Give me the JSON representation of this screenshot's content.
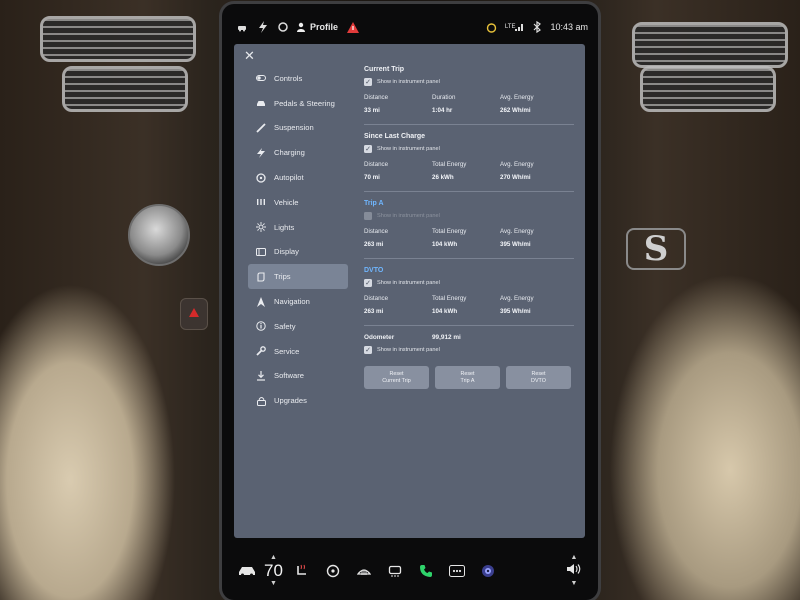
{
  "status_bar": {
    "profile_label": "Profile",
    "network_label": "LTE",
    "time": "10:43 am"
  },
  "sidebar": {
    "items": [
      {
        "label": "Controls",
        "icon": "toggle-icon"
      },
      {
        "label": "Pedals & Steering",
        "icon": "car-icon"
      },
      {
        "label": "Suspension",
        "icon": "suspension-icon"
      },
      {
        "label": "Charging",
        "icon": "lightning-icon"
      },
      {
        "label": "Autopilot",
        "icon": "steering-wheel-icon"
      },
      {
        "label": "Vehicle",
        "icon": "vehicle-bars-icon"
      },
      {
        "label": "Lights",
        "icon": "sun-icon"
      },
      {
        "label": "Display",
        "icon": "display-icon"
      },
      {
        "label": "Trips",
        "icon": "trips-icon"
      },
      {
        "label": "Navigation",
        "icon": "navigation-icon"
      },
      {
        "label": "Safety",
        "icon": "info-icon"
      },
      {
        "label": "Service",
        "icon": "wrench-icon"
      },
      {
        "label": "Software",
        "icon": "download-icon"
      },
      {
        "label": "Upgrades",
        "icon": "lock-icon"
      }
    ],
    "active_index": 8
  },
  "trips": {
    "current_trip": {
      "title": "Current Trip",
      "show_label": "Show in instrument panel",
      "checked": true,
      "labels": [
        "Distance",
        "Duration",
        "Avg. Energy"
      ],
      "values": [
        "33 mi",
        "1:04 hr",
        "262 Wh/mi"
      ]
    },
    "since_last_charge": {
      "title": "Since Last Charge",
      "show_label": "Show in instrument panel",
      "checked": true,
      "labels": [
        "Distance",
        "Total Energy",
        "Avg. Energy"
      ],
      "values": [
        "70 mi",
        "26 kWh",
        "270 Wh/mi"
      ]
    },
    "trip_a": {
      "title": "Trip A",
      "show_label": "Show in instrument panel",
      "checked": false,
      "labels": [
        "Distance",
        "Total Energy",
        "Avg. Energy"
      ],
      "values": [
        "263 mi",
        "104 kWh",
        "395 Wh/mi"
      ]
    },
    "dvto": {
      "title": "DVTO",
      "show_label": "Show in instrument panel",
      "checked": true,
      "labels": [
        "Distance",
        "Total Energy",
        "Avg. Energy"
      ],
      "values": [
        "263 mi",
        "104 kWh",
        "395 Wh/mi"
      ]
    },
    "odometer": {
      "label": "Odometer",
      "value": "99,912 mi",
      "show_label": "Show in instrument panel",
      "checked": true
    },
    "reset_buttons": [
      {
        "line1": "Reset",
        "line2": "Current Trip"
      },
      {
        "line1": "Reset",
        "line2": "Trip A"
      },
      {
        "line1": "Reset",
        "line2": "DVTO"
      }
    ]
  },
  "dock": {
    "temperature": "70",
    "icons": [
      "car-icon",
      "seat-heater-icon",
      "steering-heat-icon",
      "defrost-front-icon",
      "defrost-rear-icon",
      "phone-icon",
      "apps-icon",
      "camera-icon",
      "volume-icon"
    ],
    "accent_green": "#2fd36b",
    "accent_blue": "#6fb6ff"
  }
}
